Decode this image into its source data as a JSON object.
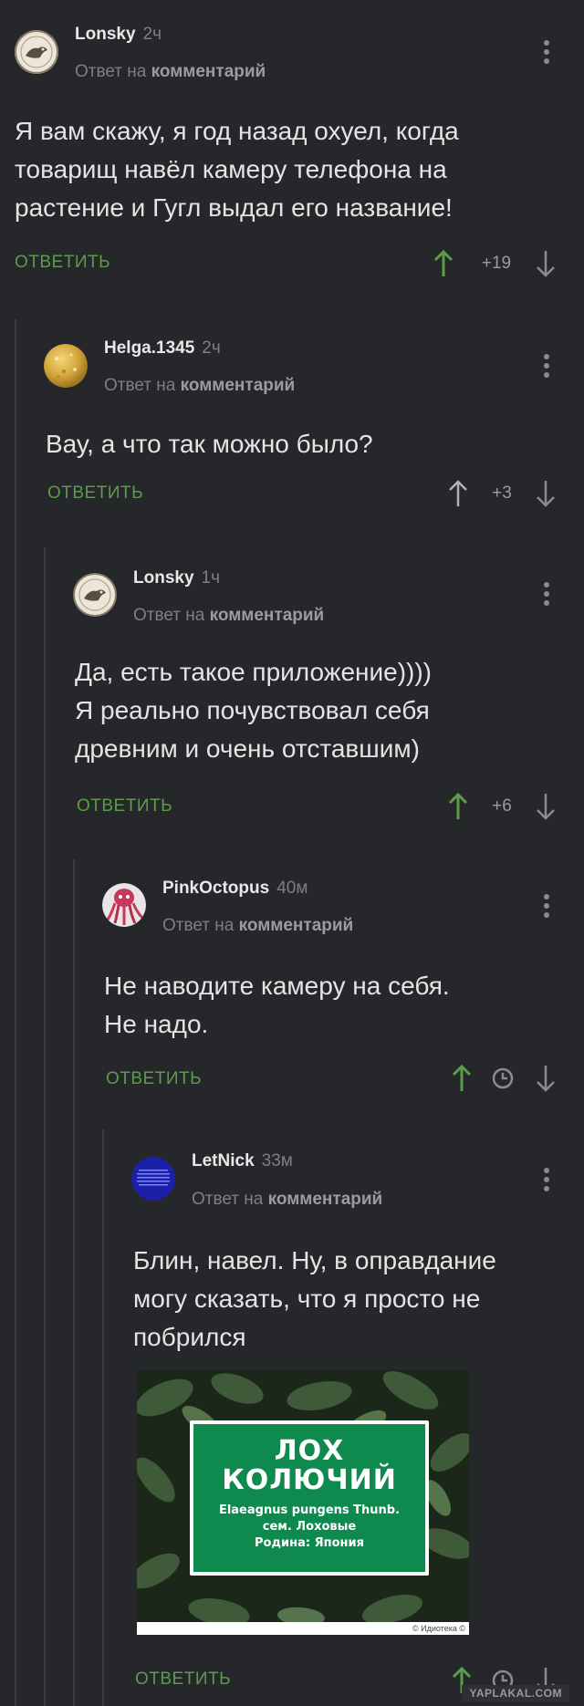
{
  "labels": {
    "reply_to_prefix": "Ответ на",
    "reply_to_link": "комментарий",
    "reply_button": "ОТВЕТИТЬ"
  },
  "comments": [
    {
      "author": "Lonsky",
      "time": "2ч",
      "text_lines": [
        "Я вам скажу, я год назад охуел, когда",
        "товарищ навёл камеру телефона на",
        "растение и Гугл выдал его название!"
      ],
      "rating": "+19"
    },
    {
      "author": "Helga.1345",
      "time": "2ч",
      "text_lines": [
        "Вау, а что так можно было?"
      ],
      "rating": "+3"
    },
    {
      "author": "Lonsky",
      "time": "1ч",
      "text_lines": [
        "Да, есть такое приложение))))",
        "Я реально почувствовал себя",
        "древним и очень отставшим)"
      ],
      "rating": "+6"
    },
    {
      "author": "PinkOctopus",
      "time": "40м",
      "text_lines": [
        "Не наводите камеру на себя.",
        "Не надо."
      ],
      "rating": ""
    },
    {
      "author": "LetNick",
      "time": "33м",
      "text_lines": [
        "Блин, навел. Ну, в оправдание",
        "могу сказать, что я просто не",
        "побрился"
      ],
      "rating": ""
    }
  ],
  "photo": {
    "sign_lines": [
      "ЛОХ",
      "КОЛЮЧИЙ",
      "Elaeagnus pungens Thunb.",
      "сем. Лоховые",
      "Родина: Япония"
    ],
    "credit": "© Идиотека ©"
  },
  "watermark": "YAPLAKAL.COM",
  "colors": {
    "background": "#25272a",
    "reply_green": "#5a9d4a",
    "upvote_green": "#5a9d4a",
    "muted": "#7d7f83",
    "sign_green": "#0e8a4f"
  },
  "icons": [
    "more-vert-icon",
    "arrow-up-icon",
    "arrow-down-icon",
    "clock-icon"
  ]
}
